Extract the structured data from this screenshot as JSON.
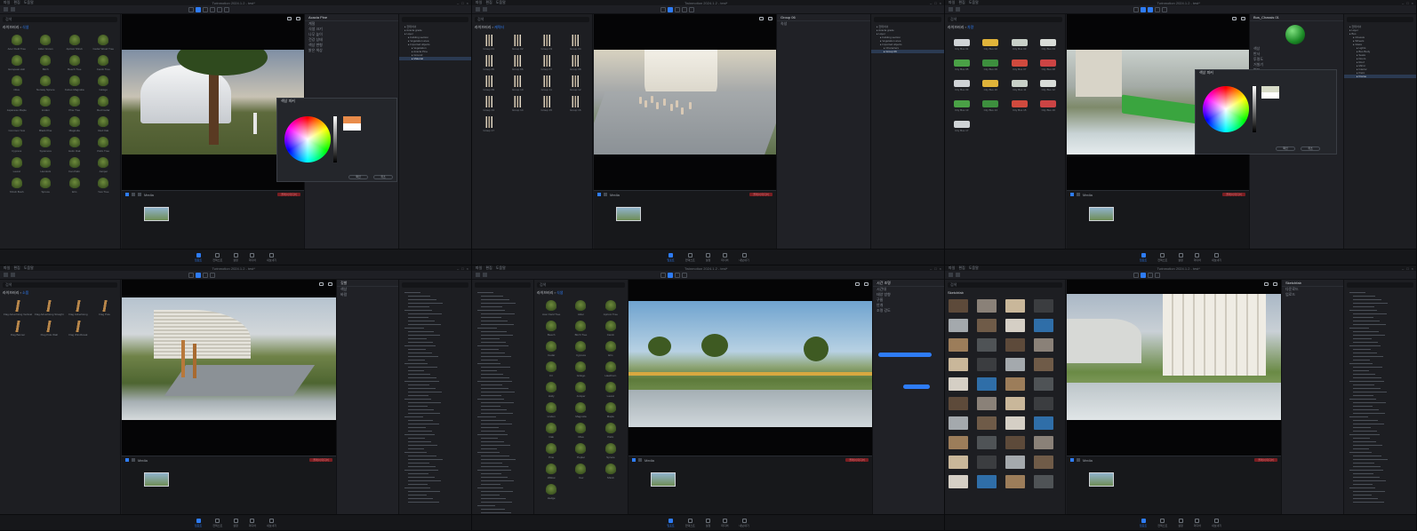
{
  "app": {
    "window_title": "Twinmotion 2024.1.2 - test*",
    "menu": [
      "파일",
      "편집",
      "도움말"
    ],
    "accent": "#2e7cf6"
  },
  "panels": [
    {
      "id": "p1",
      "library": {
        "search_placeholder": "검색",
        "crumb": "라이브러리",
        "crumb_sub": "식생",
        "items": [
          "Acer Field Tree",
          "Alder Grown",
          "Apricot Shrub",
          "Cedar Wood Tree",
          "European Ash",
          "Birch",
          "Beech Tree",
          "Carob Tree",
          "Olive",
          "Norway Spruce",
          "Kobus Magnolia",
          "Ginkgo",
          "Japanese Maple",
          "Linden",
          "Pine Tree",
          "Red Cedar",
          "Common Yew",
          "Black Pine",
          "Magnolia",
          "Red Oak",
          "Cypress",
          "Sycamore",
          "Holm Oak",
          "Palm Tree",
          "Laurel",
          "Hemlock",
          "Fan Palm",
          "Juniper",
          "Shrub Bush",
          "Spruce",
          "Elm",
          "Yew Tree"
        ]
      },
      "props": {
        "header": "Acacia Pine",
        "rows": [
          "계절",
          "식생 크기",
          "나무 높이",
          "건강 상태",
          "색상 변형",
          "밝은 색상"
        ]
      },
      "tree": [
        "컨테이너",
        "Acacia grade",
        "Layer",
        "building section",
        "Vegetation area",
        "Imported objects",
        "Vegetation",
        "Acacia Pine",
        "Ground",
        "Material"
      ],
      "picker": {
        "title": "색상 피커",
        "ok": "확인",
        "cancel": "취소"
      },
      "tl_label": "Media",
      "tl_btn": "플레이 미디어"
    },
    {
      "id": "p2",
      "library": {
        "search_placeholder": "검색",
        "crumb": "라이브러리",
        "crumb_sub": "캐릭터",
        "items": [
          "Group 01",
          "Group 02",
          "Group 03",
          "Group 04",
          "Group 05",
          "Group 06",
          "Group 07",
          "Group 08",
          "Group 09",
          "Group 10",
          "Group 11",
          "Group 12",
          "Group 13",
          "Group 14",
          "Group 15",
          "Group 16",
          "Group 17"
        ]
      },
      "props": {
        "header": "Group 06",
        "rows": [
          "속성"
        ]
      },
      "tree": [
        "컨테이너",
        "Acacia grade",
        "Layer",
        "building section",
        "Vegetation area",
        "Imported objects",
        "Characters",
        "Group 06"
      ],
      "tl_label": "Media",
      "tl_btn": "플레이 미디어"
    },
    {
      "id": "p3",
      "library": {
        "search_placeholder": "검색",
        "crumb": "라이브러리",
        "crumb_sub": "차량",
        "items": [
          "City Bus 01",
          "City Bus 02",
          "City Bus 03",
          "City Bus 04",
          "City Bus 05",
          "City Bus 06",
          "City Bus 07",
          "City Bus 08",
          "City Bus 09",
          "City Bus 10",
          "City Bus 11",
          "City Bus 12",
          "City Bus 13",
          "City Bus 14",
          "City Bus 15",
          "City Bus 16",
          "City Bus 17"
        ]
      },
      "props": {
        "header": "Bus_Chassis 01",
        "rows": [
          "색상",
          "반사",
          "투명도",
          "거칠기",
          "범프",
          "투명"
        ]
      },
      "tree": [
        "컨테이너",
        "Layer",
        "Bus",
        "Chassis",
        "Wheels",
        "Glass",
        "Lights",
        "Bus Body",
        "Seats",
        "Doors",
        "Roof",
        "Mirror",
        "Interior",
        "Paint",
        "Frame"
      ],
      "picker": {
        "title": "색상 피커",
        "ok": "확인",
        "cancel": "취소"
      },
      "tl_label": "Media",
      "tl_btn": "플레이 미디어"
    },
    {
      "id": "p4",
      "library": {
        "search_placeholder": "검색",
        "crumb": "라이브러리",
        "crumb_sub": "소품",
        "items": [
          "Flag Advertising Vertical",
          "Flag Advertising Straight",
          "Flag Advertising",
          "Flag Pole",
          "Flag Banner",
          "Flag Pole Wall",
          "Flag Windbreak"
        ]
      },
      "props": {
        "header": "깃발",
        "rows": [
          "색상",
          "바람"
        ]
      },
      "tree": [],
      "tl_label": "Media",
      "tl_btn": "플레이 미디어"
    },
    {
      "id": "p5",
      "library": {
        "search_placeholder": "검색",
        "crumb": "라이브러리",
        "crumb_sub": "식생",
        "items": [
          "Acer Field Tree",
          "Alder",
          "Apricot Tree",
          "Beech",
          "Birch Tree",
          "Carob",
          "Cedar",
          "Cypress",
          "Elm",
          "Fir",
          "Ginkgo",
          "Hawthorn",
          "Holly",
          "Juniper",
          "Laurel",
          "Linden",
          "Magnolia",
          "Maple",
          "Oak",
          "Olive",
          "Palm",
          "Pine",
          "Poplar",
          "Spruce",
          "Willow",
          "Yew",
          "Shrub",
          "Hedge"
        ]
      },
      "props": {
        "header": "시간 조명",
        "rows": [
          "시간대",
          "태양 방향",
          "구름",
          "안개",
          "조명 강도"
        ]
      },
      "tree": [],
      "tl_label": "Media",
      "tl_btn": "플레이 미디어"
    },
    {
      "id": "p6",
      "library": {
        "search_placeholder": "검색",
        "crumb": "Sketchfab",
        "crumb_sub": "",
        "items": []
      },
      "props": {
        "header": "Sketchfab",
        "rows": [
          "다운로드",
          "업로드"
        ]
      },
      "tree": [],
      "tl_label": "Media",
      "tl_btn": "플레이 미디어"
    }
  ],
  "bottom_nav": [
    "임포트",
    "컨텍스트",
    "설정",
    "미디어",
    "내보내기"
  ]
}
